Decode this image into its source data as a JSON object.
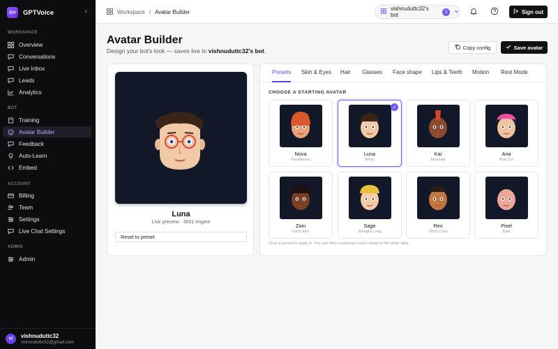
{
  "app": {
    "logo_text": "GV",
    "name": "GPTVoice"
  },
  "sidebar": {
    "sections": [
      {
        "label": "WORKSPACE",
        "items": [
          "Overview",
          "Conversations",
          "Live Inbox",
          "Leads",
          "Analytics"
        ]
      },
      {
        "label": "BOT",
        "items": [
          "Training",
          "Avatar Builder",
          "Feedback",
          "Auto-Learn",
          "Embed"
        ]
      },
      {
        "label": "ACCOUNT",
        "items": [
          "Billing",
          "Team",
          "Settings",
          "Live Chat Settings"
        ]
      },
      {
        "label": "ADMIN",
        "items": [
          "Admin"
        ]
      }
    ],
    "active_item": "Avatar Builder",
    "user": {
      "initials": "VI",
      "name": "vishnuduttc32",
      "email": "vishnuduttc32@gmail.com"
    }
  },
  "topbar": {
    "breadcrumb": [
      "Workspace",
      "/",
      "Avatar Builder"
    ],
    "bot_selector": {
      "label": "vishnuduttc32's bot",
      "count": "3"
    },
    "sign_out": "Sign out"
  },
  "header": {
    "title": "Avatar Builder",
    "subtitle_prefix": "Design your bot's look — saves live to ",
    "subtitle_bot": "vishnuduttc32's bot",
    "subtitle_suffix": ".",
    "copy_config": "Copy config",
    "save_avatar": "Save avatar"
  },
  "preview": {
    "name": "Luna",
    "meta": "Live preview · 3001 engine",
    "reset": "Reset to preset"
  },
  "editor": {
    "tabs": [
      "Presets",
      "Skin & Eyes",
      "Hair",
      "Glasses",
      "Face shape",
      "Lips & Teeth",
      "Motion",
      "Rest Mode"
    ],
    "active_tab": "Presets",
    "grid_title": "CHOOSE A STARTING AVATAR",
    "presets": [
      {
        "name": "Nova",
        "style": "Dreadlocks",
        "skin": "#e9a37b",
        "hair": "#d9572b"
      },
      {
        "name": "Luna",
        "style": "Wavy",
        "skin": "#f1c9a6",
        "hair": "#3a2418",
        "selected": true
      },
      {
        "name": "Kai",
        "style": "Mohawk",
        "skin": "#8a4a2e",
        "hair": "#d4462a"
      },
      {
        "name": "Aria",
        "style": "Bob Cut",
        "skin": "#f0c2a0",
        "hair": "#f04da0"
      },
      {
        "name": "Zion",
        "style": "Curly Afro",
        "skin": "#7a3f24",
        "hair": "#1c1210"
      },
      {
        "name": "Sage",
        "style": "Straight Long",
        "skin": "#f2cda8",
        "hair": "#e9c23a"
      },
      {
        "name": "Rex",
        "style": "Short Crop",
        "skin": "#c07840",
        "hair": "#2a1d16"
      },
      {
        "name": "Pixel",
        "style": "Bald",
        "skin": "#e9a89a",
        "hair": "none"
      }
    ],
    "hint": "Click a preset to apply it. You can then customize every detail in the other tabs."
  },
  "colors": {
    "accent": "#6d5cf6",
    "sidebar_bg": "#0d0d10",
    "stage_bg": "#121827"
  }
}
